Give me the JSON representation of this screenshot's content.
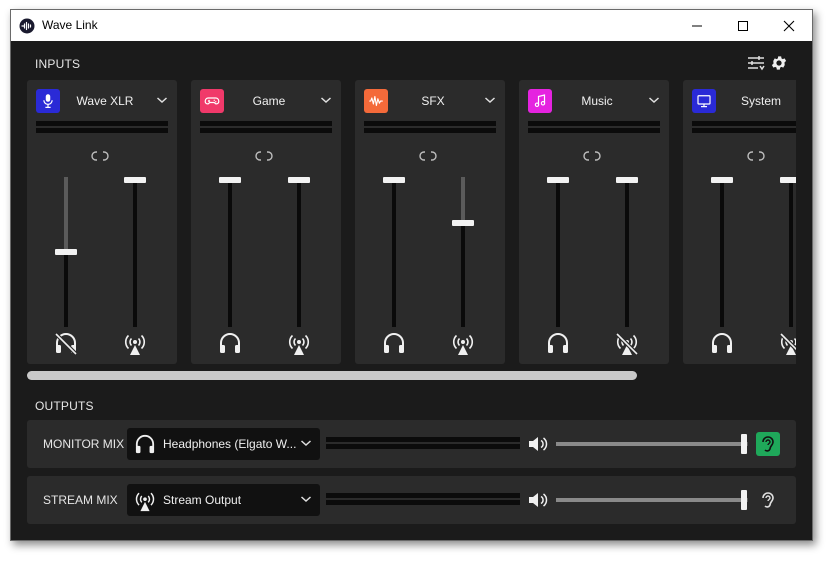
{
  "window": {
    "title": "Wave Link"
  },
  "sections": {
    "inputs": "INPUTS",
    "outputs": "OUTPUTS"
  },
  "channels": [
    {
      "name": "Wave XLR",
      "icon": "microphone-icon",
      "icon_color": "#2a2ad6",
      "monitor_level": 0.5,
      "stream_level": 1.0,
      "monitor_muted": true,
      "stream_muted": false
    },
    {
      "name": "Game",
      "icon": "gamepad-icon",
      "icon_color": "#f0396a",
      "monitor_level": 1.0,
      "stream_level": 1.0,
      "monitor_muted": false,
      "stream_muted": false
    },
    {
      "name": "SFX",
      "icon": "waveform-icon",
      "icon_color": "#f46a3a",
      "monitor_level": 1.0,
      "stream_level": 0.7,
      "monitor_muted": false,
      "stream_muted": false
    },
    {
      "name": "Music",
      "icon": "music-note-icon",
      "icon_color": "#e523e0",
      "monitor_level": 1.0,
      "stream_level": 1.0,
      "monitor_muted": false,
      "stream_muted": true
    },
    {
      "name": "System",
      "icon": "monitor-icon",
      "icon_color": "#2a2ad6",
      "monitor_level": 1.0,
      "stream_level": 1.0,
      "monitor_muted": false,
      "stream_muted": true
    }
  ],
  "outputs": {
    "monitor": {
      "label": "MONITOR MIX",
      "device": "Headphones (Elgato W...",
      "device_icon": "headphones-icon",
      "volume": 0.98,
      "ear_active": true,
      "ear_color": "#1fa85a"
    },
    "stream": {
      "label": "STREAM MIX",
      "device": "Stream Output",
      "device_icon": "broadcast-icon",
      "volume": 0.98,
      "ear_active": false
    }
  }
}
